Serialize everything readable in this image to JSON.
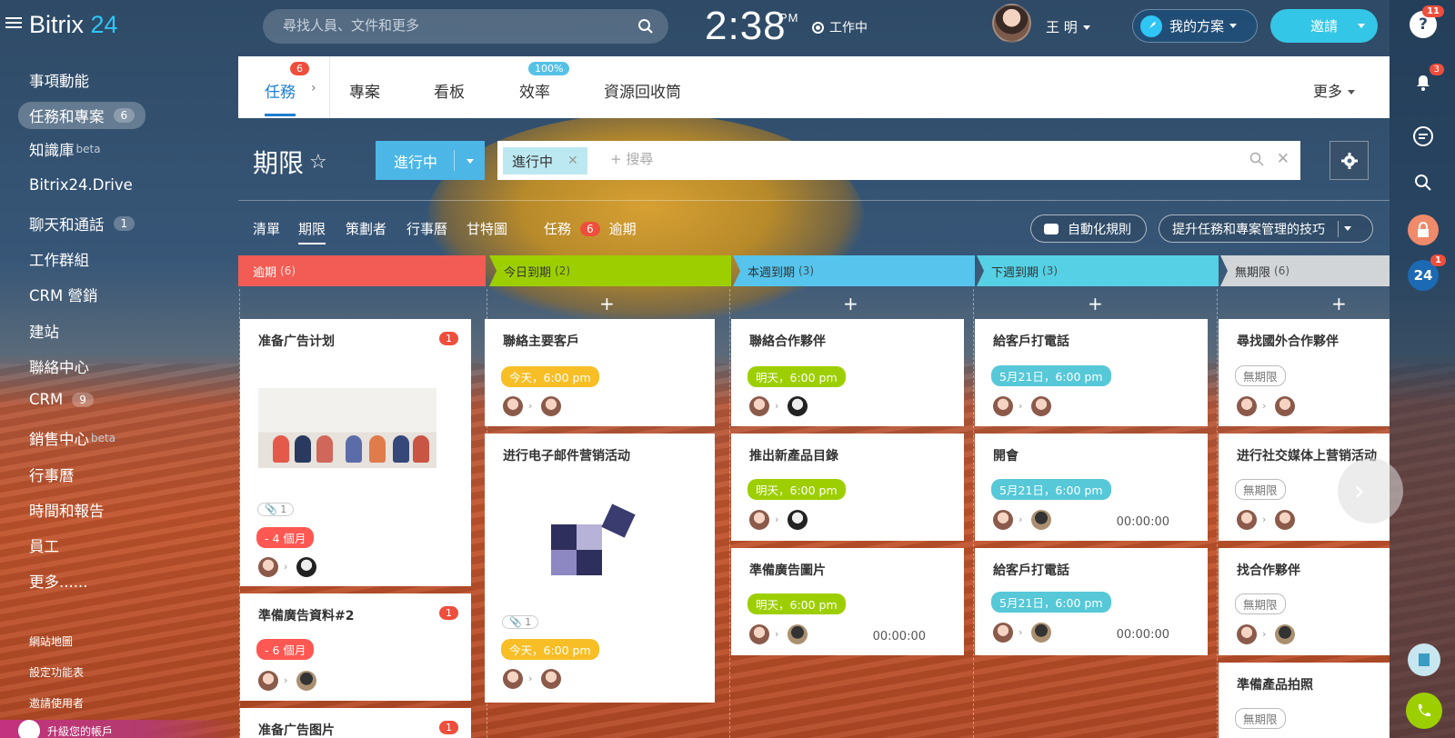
{
  "app": {
    "logo_text": "Bitrix",
    "logo_num": "24"
  },
  "search": {
    "placeholder": "尋找人員、文件和更多"
  },
  "clock": {
    "time": "2:38",
    "ampm": "PM",
    "work_status": "工作中"
  },
  "user": {
    "name": "王 明"
  },
  "header": {
    "my_plan": "我的方案",
    "invite": "邀請"
  },
  "rail": {
    "help_badge": "11",
    "bell_badge": "3",
    "b24_label": "24",
    "b24_badge": "1"
  },
  "menu": {
    "items": [
      {
        "label": "事項動能"
      },
      {
        "label": "任務和專案",
        "count": "6"
      },
      {
        "label": "知識庫",
        "sup": "beta"
      },
      {
        "label": "Bitrix24.Drive"
      },
      {
        "label": "聊天和通話",
        "count": "1"
      },
      {
        "label": "工作群組"
      },
      {
        "label": "CRM 營銷"
      },
      {
        "label": "建站"
      },
      {
        "label": "聯絡中心"
      },
      {
        "label": "CRM",
        "count": "9"
      },
      {
        "label": "銷售中心",
        "sup": "beta"
      },
      {
        "label": "行事曆"
      },
      {
        "label": "時間和報告"
      },
      {
        "label": "員工"
      },
      {
        "label": "更多......"
      }
    ],
    "small": [
      "網站地圖",
      "設定功能表",
      "邀請使用者"
    ],
    "upgrade": "升級您的帳戶"
  },
  "tabs": [
    {
      "label": "任務",
      "badge": "6"
    },
    {
      "label": "專案"
    },
    {
      "label": "看板"
    },
    {
      "label": "效率",
      "badge": "100%"
    },
    {
      "label": "資源回收筒"
    }
  ],
  "tabs_more": "更多",
  "page": {
    "title": "期限",
    "status_button": "進行中",
    "filter_chip": "進行中",
    "filter_placeholder": "+ 搜尋"
  },
  "views": [
    "清單",
    "期限",
    "策劃者",
    "行事曆",
    "甘特圖"
  ],
  "overdue_summary": {
    "label": "任務",
    "count": "6",
    "suffix": "逾期"
  },
  "buttons": {
    "automation": "自動化規則",
    "tips": "提升任務和專案管理的技巧"
  },
  "columns": [
    {
      "title": "逾期",
      "count": "(6)",
      "color": "#f25c54"
    },
    {
      "title": "今日到期",
      "count": "(2)",
      "color": "#9dcf00"
    },
    {
      "title": "本週到期",
      "count": "(3)",
      "color": "#56c4ec"
    },
    {
      "title": "下週到期",
      "count": "(3)",
      "color": "#56d0e4"
    },
    {
      "title": "無期限",
      "count": "(6)",
      "color": "#d2d5d8"
    }
  ],
  "cards": {
    "c1": {
      "title": "准备广告计划",
      "count": "1",
      "attach": "1",
      "deadline": "- 4 個月"
    },
    "c2": {
      "title": "準備廣告資料#2",
      "count": "1",
      "deadline": "- 6 個月"
    },
    "c3": {
      "title": "准备广告图片",
      "count": "1"
    },
    "d1": {
      "title": "聯絡主要客戶",
      "deadline": "今天，6:00 pm"
    },
    "d2": {
      "title": "进行电子邮件营销活动",
      "attach": "1",
      "deadline": "今天，6:00 pm"
    },
    "e1": {
      "title": "聯絡合作夥伴",
      "deadline": "明天，6:00 pm"
    },
    "e2": {
      "title": "推出新產品目錄",
      "deadline": "明天，6:00 pm"
    },
    "e3": {
      "title": "準備廣告圖片",
      "deadline": "明天，6:00 pm",
      "timer": "00:00:00"
    },
    "f1": {
      "title": "給客戶打電話",
      "deadline": "5月21日，6:00 pm"
    },
    "f2": {
      "title": "開會",
      "deadline": "5月21日，6:00 pm",
      "timer": "00:00:00"
    },
    "f3": {
      "title": "給客戶打電話",
      "deadline": "5月21日，6:00 pm",
      "timer": "00:00:00"
    },
    "g1": {
      "title": "尋找國外合作夥伴",
      "deadline": "無期限"
    },
    "g2": {
      "title": "进行社交媒体上营销活动",
      "deadline": "無期限"
    },
    "g3": {
      "title": "找合作夥伴",
      "deadline": "無期限"
    },
    "g4": {
      "title": "準備產品拍照",
      "deadline": "無期限"
    }
  }
}
